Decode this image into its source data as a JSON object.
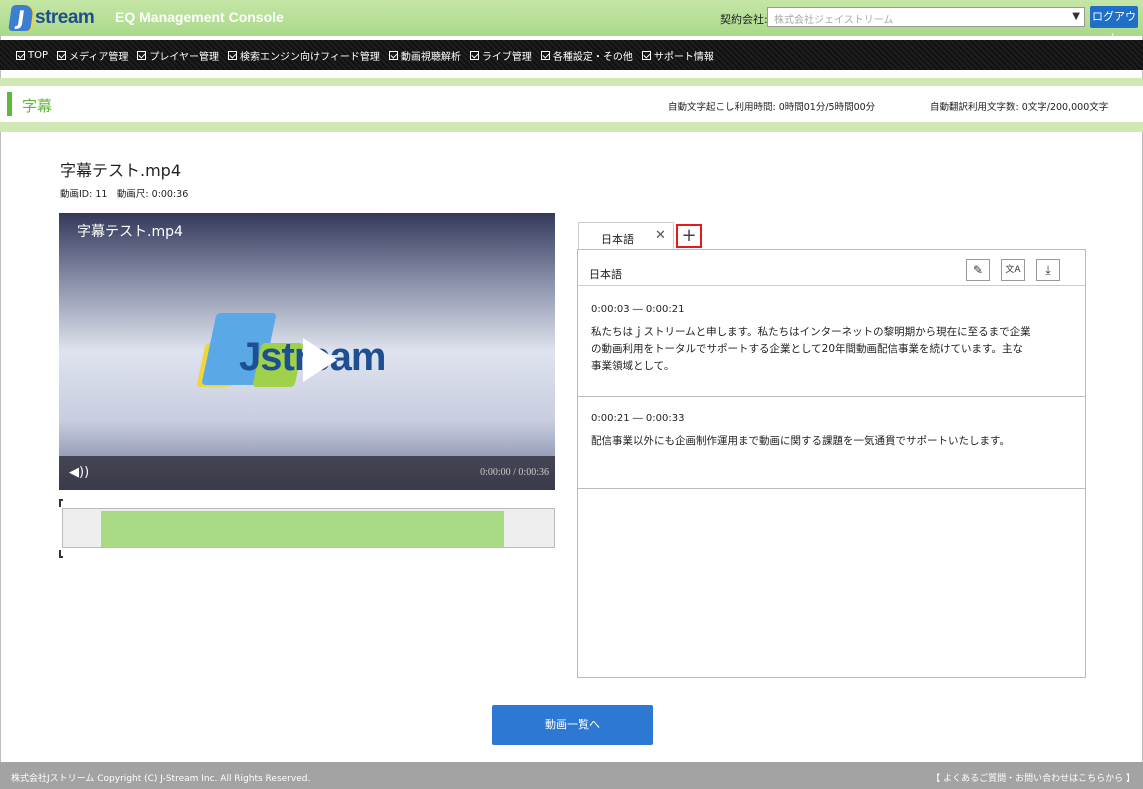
{
  "header": {
    "logo_letter": "J",
    "logo_text": "stream",
    "console_title": "EQ Management Console",
    "company_label": "契約会社:",
    "company_value": "株式会社ジェイストリーム",
    "logout_label": "ログアウト"
  },
  "nav": {
    "items": [
      "TOP",
      "メディア管理",
      "プレイヤー管理",
      "検索エンジン向けフィード管理",
      "動画視聴解析",
      "ライブ管理",
      "各種設定・その他",
      "サポート情報"
    ]
  },
  "page": {
    "title": "字幕",
    "usage_transcription": "自動文字起こし利用時間: 0時間01分/5時間00分",
    "usage_translation": "自動翻訳利用文字数: 0文字/200,000文字"
  },
  "file": {
    "name": "字幕テスト.mp4",
    "meta": "動画ID: 11　動画尺: 0:00:36"
  },
  "video": {
    "overlay_title": "字幕テスト.mp4",
    "logo_text": "Jstream",
    "time": "0:00:00 / 0:00:36"
  },
  "timeline": {
    "filled_fraction": 0.82
  },
  "subtitles": {
    "tab_label": "日本語",
    "tab_add_label": "+",
    "panel_lang": "日本語",
    "cues": [
      {
        "time": "0:00:03 ― 0:00:21",
        "text": "私たちはｊストリームと申します。私たちはインターネットの黎明期から現在に至るまで企業の動画利用をトータルでサポートする企業として20年間動画配信事業を続けています。主な事業領域として。"
      },
      {
        "time": "0:00:21 ― 0:00:33",
        "text": "配信事業以外にも企画制作運用まで動画に関する課題を一気通貫でサポートいたします。"
      }
    ]
  },
  "back_button": "動画一覧へ",
  "footer": {
    "copyright": "株式会社Jストリーム  Copyright (C) J-Stream Inc. All Rights Reserved.",
    "help_link": "【 よくあるご質問・お問い合わせはこちらから 】"
  },
  "colors": {
    "accent_green": "#5fb83a",
    "primary_blue": "#2d78d2",
    "highlight_red": "#e31b1b"
  }
}
